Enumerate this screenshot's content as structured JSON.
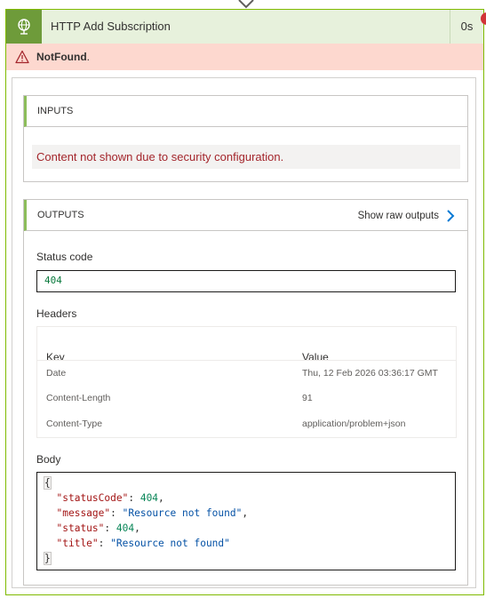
{
  "action": {
    "title": "HTTP Add Subscription",
    "duration": "0s",
    "error_badge": "!"
  },
  "error": {
    "code": "NotFound",
    "suffix": "."
  },
  "inputs": {
    "title": "INPUTS",
    "message": "Content not shown due to security configuration."
  },
  "outputs": {
    "title": "OUTPUTS",
    "raw_link": "Show raw outputs",
    "status_label": "Status code",
    "status_value": "404",
    "headers_label": "Headers",
    "headers_columns": [
      "Key",
      "Value"
    ],
    "headers": [
      {
        "key": "Date",
        "value": "Thu, 12 Feb 2026 03:36:17 GMT"
      },
      {
        "key": "Content-Length",
        "value": "91"
      },
      {
        "key": "Content-Type",
        "value": "application/problem+json"
      }
    ],
    "body_label": "Body",
    "body_json": [
      {
        "key": "statusCode",
        "value": "404",
        "kind": "number"
      },
      {
        "key": "message",
        "value": "Resource not found",
        "kind": "string"
      },
      {
        "key": "status",
        "value": "404",
        "kind": "number"
      },
      {
        "key": "title",
        "value": "Resource not found",
        "kind": "string"
      }
    ]
  },
  "colors": {
    "accent_green": "#7fba00",
    "header_bg": "#e7f1dc",
    "icon_bg": "#6e9b3a",
    "error_bg": "#fdd8cf",
    "error_text": "#a4262c",
    "link_chevron": "#0078d4"
  },
  "icons": {
    "action": "globe-icon",
    "warning": "warning-triangle-icon",
    "raw_link": "chevron-right-icon"
  }
}
